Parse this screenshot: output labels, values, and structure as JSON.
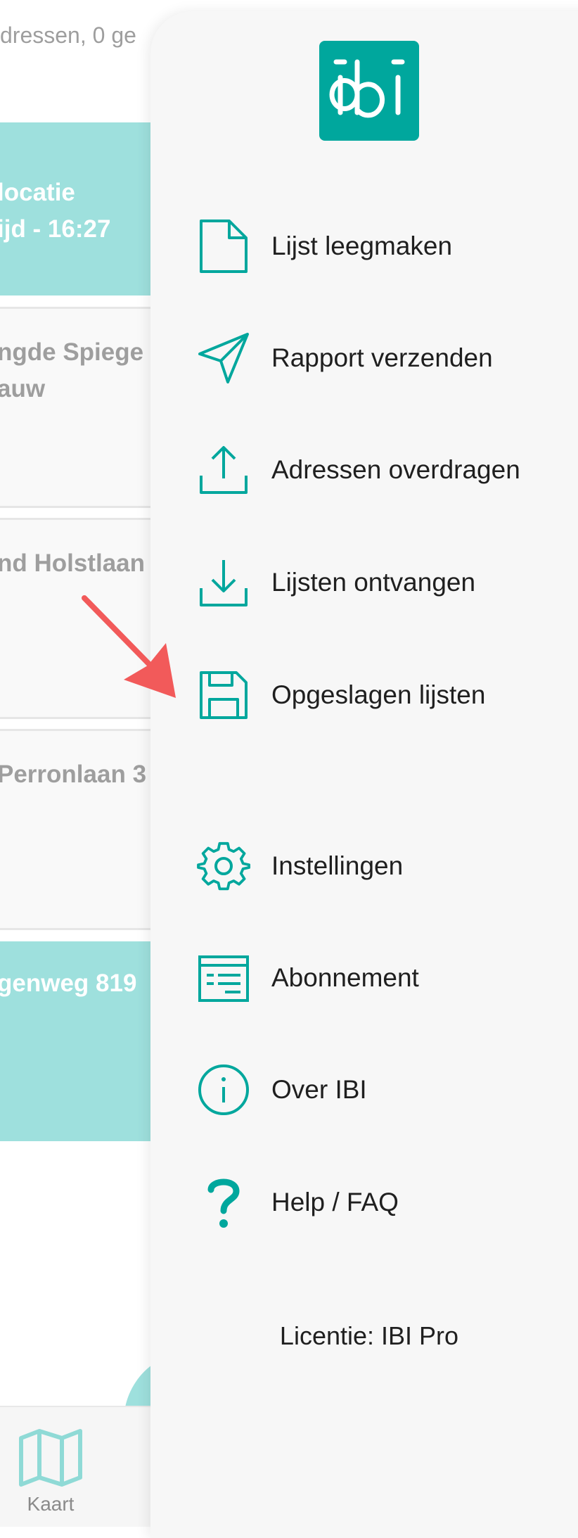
{
  "background": {
    "header_text": "dressen, 0 ge",
    "cards": [
      {
        "lines": [
          "locatie",
          "ijd - 16:27"
        ],
        "style": "teal"
      },
      {
        "lines": [
          "ngde Spiege",
          "auw"
        ],
        "style": "plain"
      },
      {
        "lines": [
          "nd Holstlaan"
        ],
        "style": "plain"
      },
      {
        "lines": [
          " Perronlaan 3"
        ],
        "style": "plain"
      },
      {
        "lines": [
          "genweg 819"
        ],
        "style": "teal"
      }
    ],
    "bottom_nav": {
      "map_label": "Kaart"
    }
  },
  "drawer": {
    "logo_text": "ibi",
    "menu": [
      {
        "label": "Lijst leegmaken",
        "icon": "file-icon"
      },
      {
        "label": "Rapport verzenden",
        "icon": "send-icon"
      },
      {
        "label": "Adressen overdragen",
        "icon": "upload-icon"
      },
      {
        "label": "Lijsten ontvangen",
        "icon": "download-icon"
      },
      {
        "label": "Opgeslagen lijsten",
        "icon": "save-icon"
      },
      {
        "label": "Instellingen",
        "icon": "gear-icon"
      },
      {
        "label": "Abonnement",
        "icon": "subscription-icon"
      },
      {
        "label": "Over IBI",
        "icon": "info-icon"
      },
      {
        "label": "Help / FAQ",
        "icon": "question-icon"
      }
    ],
    "license": "Licentie: IBI Pro"
  },
  "colors": {
    "accent": "#00a79d",
    "card_teal": "#9ee0dd",
    "arrow": "#f25a5a"
  }
}
